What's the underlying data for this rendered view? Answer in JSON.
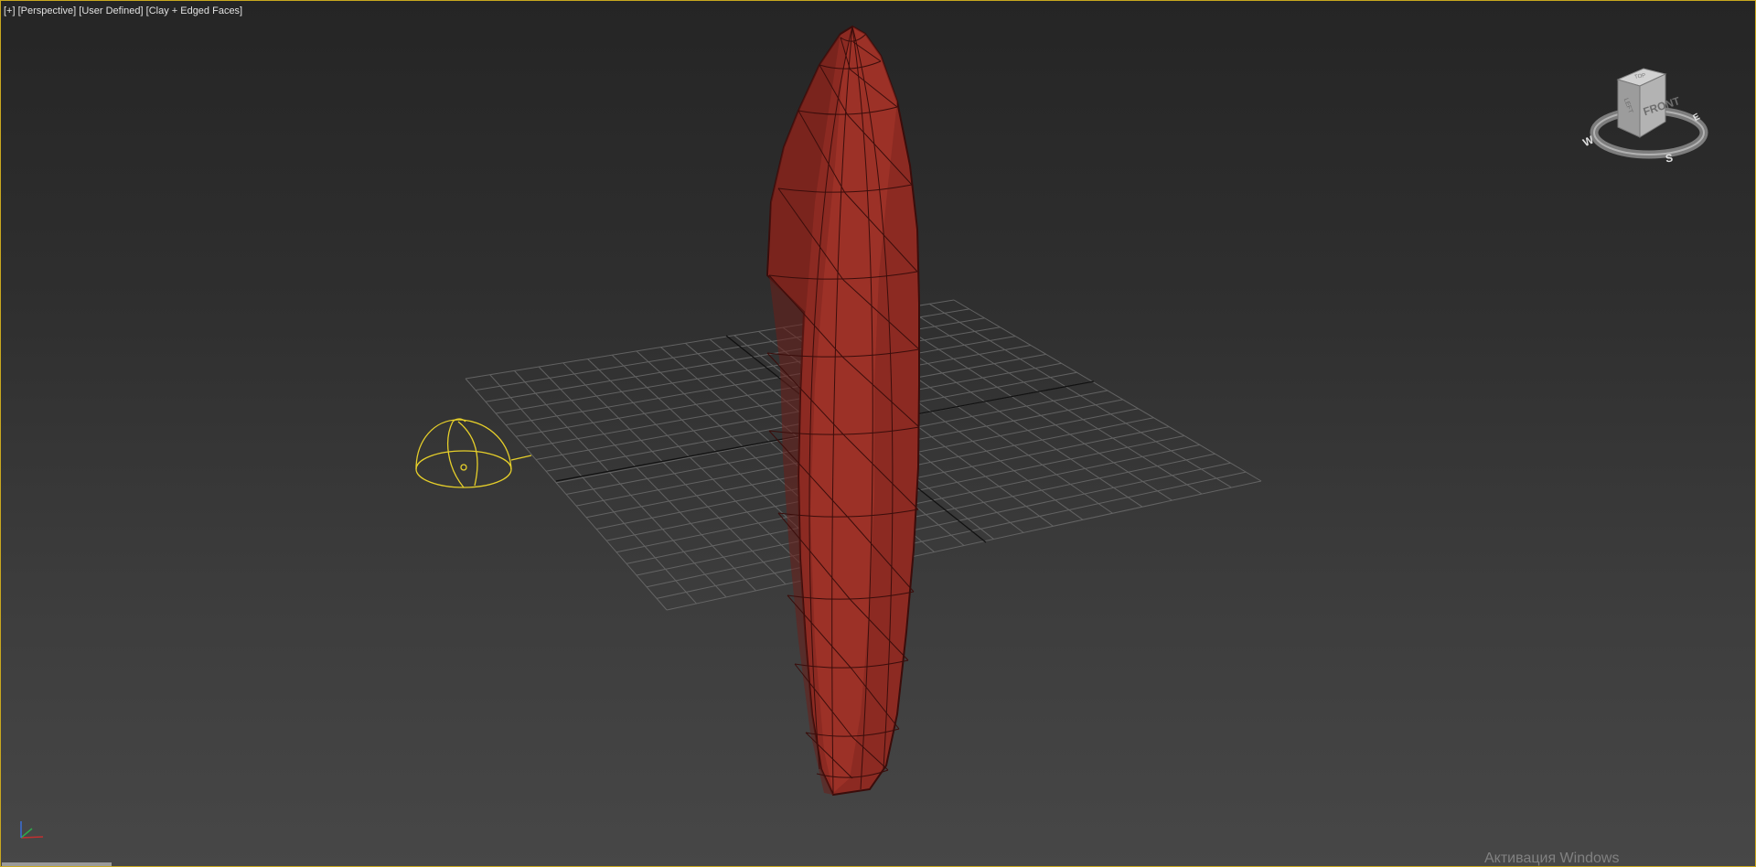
{
  "viewport": {
    "label_plus": "[+]",
    "label_view": "[Perspective]",
    "label_camera": "[User Defined]",
    "label_shading": "[Clay + Edged Faces]",
    "border_color": "#c9a81f",
    "active": true
  },
  "viewcube": {
    "face_front": "FRONT",
    "face_left": "LEFT",
    "face_top": "TOP",
    "compass_w": "W",
    "compass_s": "S",
    "compass_e": "E"
  },
  "scene": {
    "mesh_color": "#8c2a22",
    "light_color": "#e6cf2a",
    "grid_color": "#6b6b6b"
  },
  "watermark": {
    "text": "Активация Windows"
  },
  "axis_tripod": {
    "icon": "axis-tripod-icon"
  }
}
